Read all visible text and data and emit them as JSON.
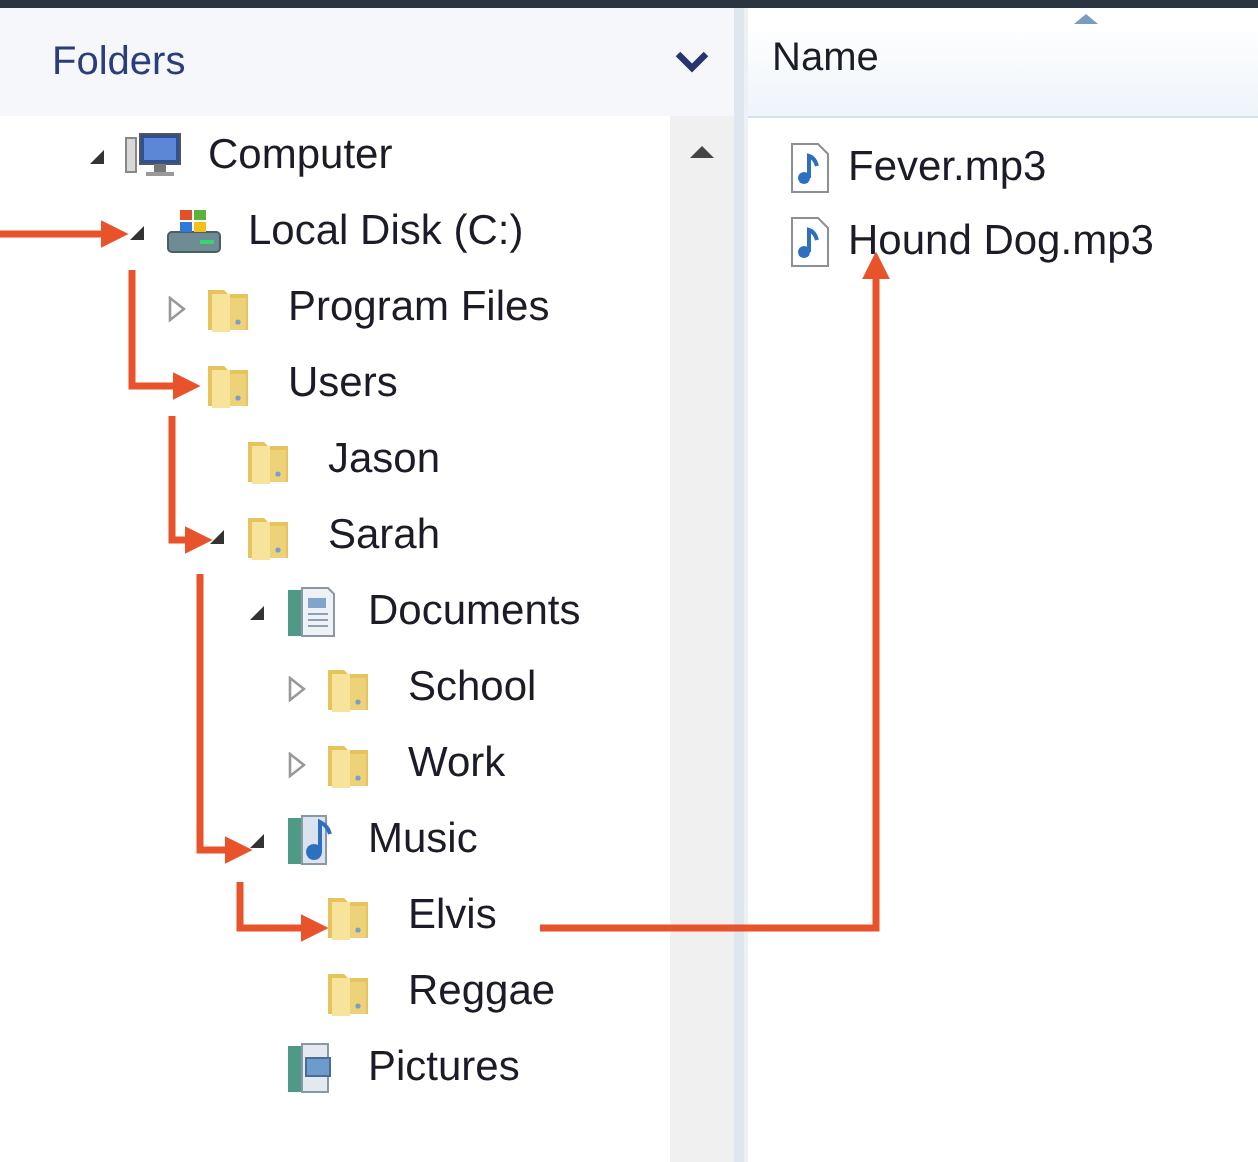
{
  "folders_pane": {
    "title": "Folders",
    "tree": [
      {
        "label": "Computer",
        "kind": "computer",
        "expanded": true,
        "children": [
          {
            "label": "Local Disk (C:)",
            "kind": "drive",
            "expanded": true,
            "children": [
              {
                "label": "Program Files",
                "kind": "folder",
                "expanded": false
              },
              {
                "label": "Users",
                "kind": "folder",
                "children": [
                  {
                    "label": "Jason",
                    "kind": "folder"
                  },
                  {
                    "label": "Sarah",
                    "kind": "folder",
                    "expanded": true,
                    "children": [
                      {
                        "label": "Documents",
                        "kind": "documents",
                        "expanded": true,
                        "children": [
                          {
                            "label": "School",
                            "kind": "folder",
                            "expanded": false
                          },
                          {
                            "label": "Work",
                            "kind": "folder",
                            "expanded": false
                          }
                        ]
                      },
                      {
                        "label": "Music",
                        "kind": "music",
                        "expanded": true,
                        "children": [
                          {
                            "label": "Elvis",
                            "kind": "folder"
                          },
                          {
                            "label": "Reggae",
                            "kind": "folder"
                          }
                        ]
                      },
                      {
                        "label": "Pictures",
                        "kind": "pictures"
                      }
                    ]
                  }
                ]
              }
            ]
          }
        ]
      }
    ]
  },
  "file_list": {
    "columns": [
      "Name"
    ],
    "files": [
      {
        "name": "Fever.mp3",
        "kind": "audio"
      },
      {
        "name": "Hound Dog.mp3",
        "kind": "audio"
      }
    ]
  }
}
